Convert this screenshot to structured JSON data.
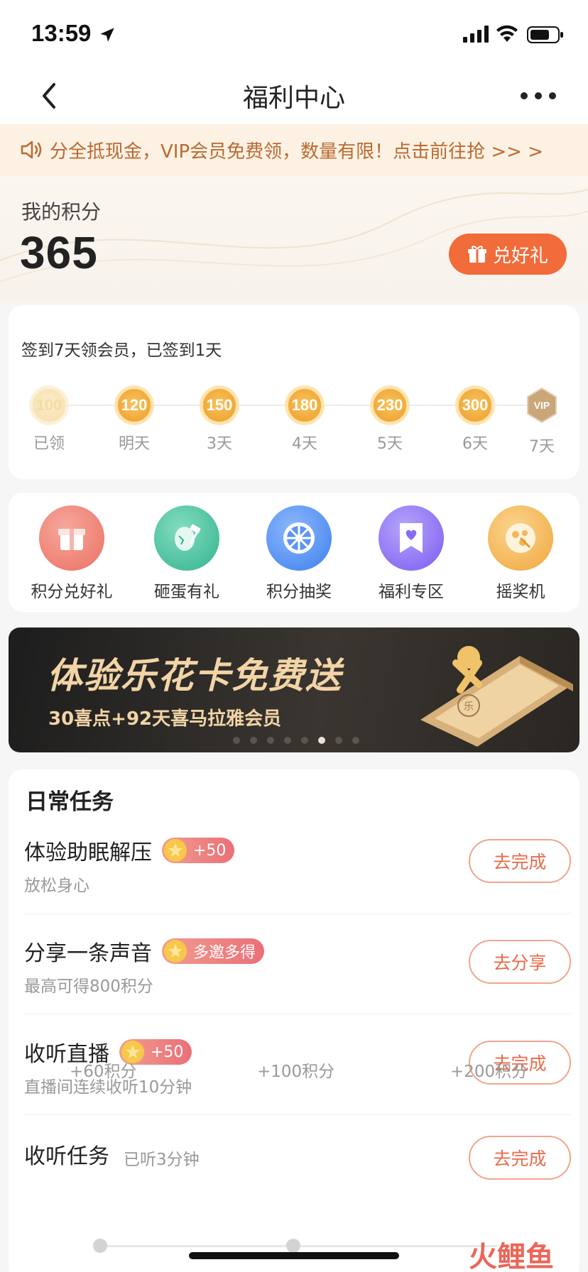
{
  "status_bar": {
    "time": "13:59"
  },
  "nav": {
    "title": "福利中心"
  },
  "notice": {
    "text": "分全抵现金，VIP会员免费领，数量有限！点击前往抢 >> >"
  },
  "points": {
    "label": "我的积分",
    "value": "365",
    "redeem_label": "兑好礼"
  },
  "checkin": {
    "title": "签到7天领会员，已签到1天",
    "days": [
      {
        "points": "100",
        "label": "已领"
      },
      {
        "points": "120",
        "label": "明天"
      },
      {
        "points": "150",
        "label": "3天"
      },
      {
        "points": "180",
        "label": "4天"
      },
      {
        "points": "230",
        "label": "5天"
      },
      {
        "points": "300",
        "label": "6天"
      },
      {
        "badge": "VIP",
        "label": "7天"
      }
    ]
  },
  "shortcuts": [
    {
      "label": "积分兑好礼",
      "icon": "gift-box-icon",
      "color": "#f07a6d"
    },
    {
      "label": "砸蛋有礼",
      "icon": "egg-hammer-icon",
      "color": "#3fbf9a"
    },
    {
      "label": "积分抽奖",
      "icon": "prize-wheel-icon",
      "color": "#4a8ef0"
    },
    {
      "label": "福利专区",
      "icon": "heart-ribbon-icon",
      "color": "#8a6cf0"
    },
    {
      "label": "摇奖机",
      "icon": "lottery-machine-icon",
      "color": "#f2b454"
    }
  ],
  "banner": {
    "title": "体验乐花卡免费送",
    "subtitle": "30喜点+92天喜马拉雅会员",
    "art_text": "乐",
    "active_index": 5,
    "total": 8
  },
  "tasks": {
    "title": "日常任务",
    "items": [
      {
        "name": "体验助眠解压",
        "reward": "+50",
        "desc": "放松身心",
        "button": "去完成"
      },
      {
        "name": "分享一条声音",
        "reward": "多邀多得",
        "desc": "最高可得800积分",
        "button": "去分享"
      },
      {
        "name": "收听直播",
        "reward": "+50",
        "desc": "直播间连续收听10分钟",
        "button": "去完成"
      },
      {
        "name": "收听任务",
        "inline_desc": "已听3分钟",
        "button": "去完成"
      }
    ],
    "listen_milestones": [
      "+60积分",
      "+100积分",
      "+200积分"
    ]
  },
  "watermark": "火鲤鱼",
  "colors": {
    "accent": "#f26b3a",
    "notice_text": "#b86a32",
    "coin": "#f1a83a"
  }
}
